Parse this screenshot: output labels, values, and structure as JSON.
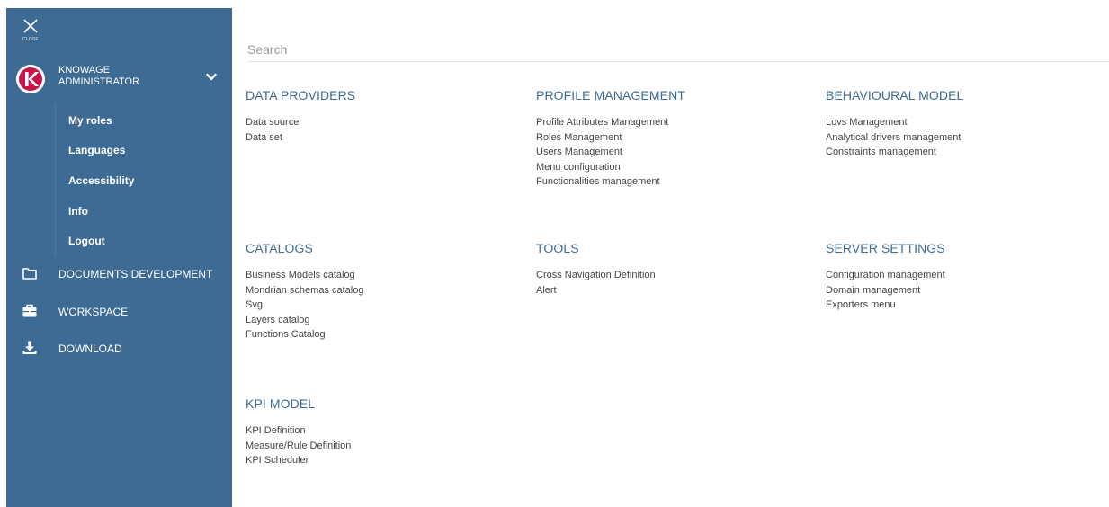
{
  "sidebar": {
    "close_label": "CLOSE",
    "user": {
      "line1": "KNOWAGE",
      "line2": "ADMINISTRATOR",
      "avatar_letter": "K"
    },
    "submenu": [
      "My roles",
      "Languages",
      "Accessibility",
      "Info",
      "Logout"
    ],
    "nav": [
      {
        "label": "DOCUMENTS DEVELOPMENT",
        "icon": "folder-icon"
      },
      {
        "label": "WORKSPACE",
        "icon": "briefcase-icon"
      },
      {
        "label": "DOWNLOAD",
        "icon": "download-icon"
      }
    ],
    "background_color": "#3d6b94"
  },
  "search": {
    "placeholder": "Search"
  },
  "sections": [
    {
      "title": "DATA PROVIDERS",
      "items": [
        "Data source",
        "Data set"
      ]
    },
    {
      "title": "PROFILE MANAGEMENT",
      "items": [
        "Profile Attributes Management",
        "Roles Management",
        "Users Management",
        "Menu configuration",
        "Functionalities management"
      ]
    },
    {
      "title": "BEHAVIOURAL MODEL",
      "items": [
        "Lovs Management",
        "Analytical drivers management",
        "Constraints management"
      ]
    },
    {
      "title": "CATALOGS",
      "items": [
        "Business Models catalog",
        "Mondrian schemas catalog",
        "Svg",
        "Layers catalog",
        "Functions Catalog"
      ]
    },
    {
      "title": "TOOLS",
      "items": [
        "Cross Navigation Definition",
        "Alert"
      ]
    },
    {
      "title": "SERVER SETTINGS",
      "items": [
        "Configuration management",
        "Domain management",
        "Exporters menu"
      ]
    },
    {
      "title": "KPI MODEL",
      "items": [
        "KPI Definition",
        "Measure/Rule Definition",
        "KPI Scheduler"
      ]
    }
  ],
  "colors": {
    "accent": "#3d6b94",
    "avatar_ring": "#c8144a"
  }
}
